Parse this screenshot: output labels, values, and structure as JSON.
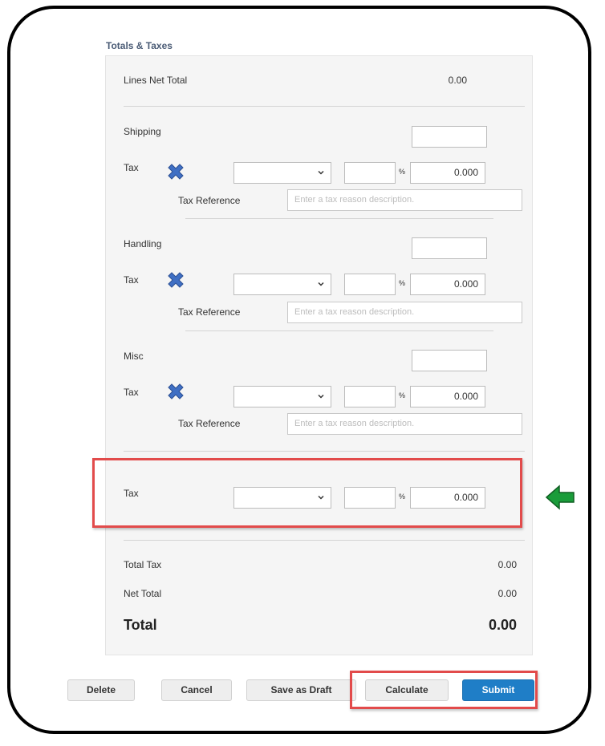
{
  "section_title": "Totals & Taxes",
  "lines_net_total": {
    "label": "Lines Net Total",
    "value": "0.00"
  },
  "groups": [
    {
      "label": "Shipping",
      "amount": "",
      "tax_label": "Tax",
      "tax_code": "",
      "tax_rate": "",
      "percent_sign": "%",
      "tax_amount": "0.000",
      "tax_reference_label": "Tax Reference",
      "tax_reference_placeholder": "Enter a tax reason description."
    },
    {
      "label": "Handling",
      "amount": "",
      "tax_label": "Tax",
      "tax_code": "",
      "tax_rate": "",
      "percent_sign": "%",
      "tax_amount": "0.000",
      "tax_reference_label": "Tax Reference",
      "tax_reference_placeholder": "Enter a tax reason description."
    },
    {
      "label": "Misc",
      "amount": "",
      "tax_label": "Tax",
      "tax_code": "",
      "tax_rate": "",
      "percent_sign": "%",
      "tax_amount": "0.000",
      "tax_reference_label": "Tax Reference",
      "tax_reference_placeholder": "Enter a tax reason description."
    }
  ],
  "header_tax": {
    "label": "Tax",
    "tax_code": "",
    "tax_rate": "",
    "percent_sign": "%",
    "tax_amount": "0.000"
  },
  "totals": {
    "total_tax_label": "Total Tax",
    "total_tax_value": "0.00",
    "net_total_label": "Net Total",
    "net_total_value": "0.00",
    "total_label": "Total",
    "total_value": "0.00"
  },
  "buttons": {
    "delete": "Delete",
    "cancel": "Cancel",
    "save_draft": "Save as Draft",
    "calculate": "Calculate",
    "submit": "Submit"
  },
  "icons": {
    "remove": "x-remove-icon",
    "arrow": "arrow-left-icon",
    "chevron": "chevron-down-icon"
  },
  "colors": {
    "accent": "#1f7ec7",
    "highlight": "#e24b4b",
    "arrow": "#1a9c3a",
    "x_icon": "#3f6fc4"
  }
}
